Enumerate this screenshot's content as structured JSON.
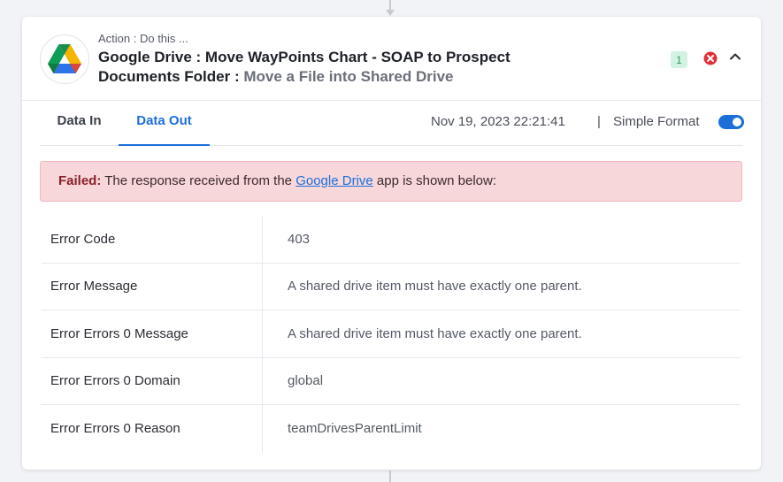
{
  "header": {
    "action_label": "Action : Do this ...",
    "title_main": "Google Drive : Move WayPoints Chart - SOAP to Prospect Documents Folder :",
    "title_sub": "Move a File into Shared Drive",
    "badge": "1"
  },
  "tabs": [
    {
      "label": "Data In"
    },
    {
      "label": "Data Out"
    }
  ],
  "meta": {
    "timestamp": "Nov 19, 2023 22:21:41",
    "separator": "|",
    "format_label": "Simple Format",
    "simple_format_on": true
  },
  "alert": {
    "failed_label": "Failed:",
    "text_before": "The response received from the",
    "link_text": "Google Drive",
    "text_after": "app is shown below:"
  },
  "rows": [
    {
      "key": "Error Code",
      "value": "403"
    },
    {
      "key": "Error Message",
      "value": "A shared drive item must have exactly one parent."
    },
    {
      "key": "Error Errors 0 Message",
      "value": "A shared drive item must have exactly one parent."
    },
    {
      "key": "Error Errors 0 Domain",
      "value": "global"
    },
    {
      "key": "Error Errors 0 Reason",
      "value": "teamDrivesParentLimit"
    }
  ],
  "colors": {
    "accent": "#1c6fd9",
    "error": "#e0303a",
    "alert_bg": "#f8d7da",
    "badge_bg": "#d3f3e2"
  },
  "icons": {
    "app": "google-drive-icon",
    "status": "error-icon",
    "collapse": "chevron-up-icon"
  }
}
